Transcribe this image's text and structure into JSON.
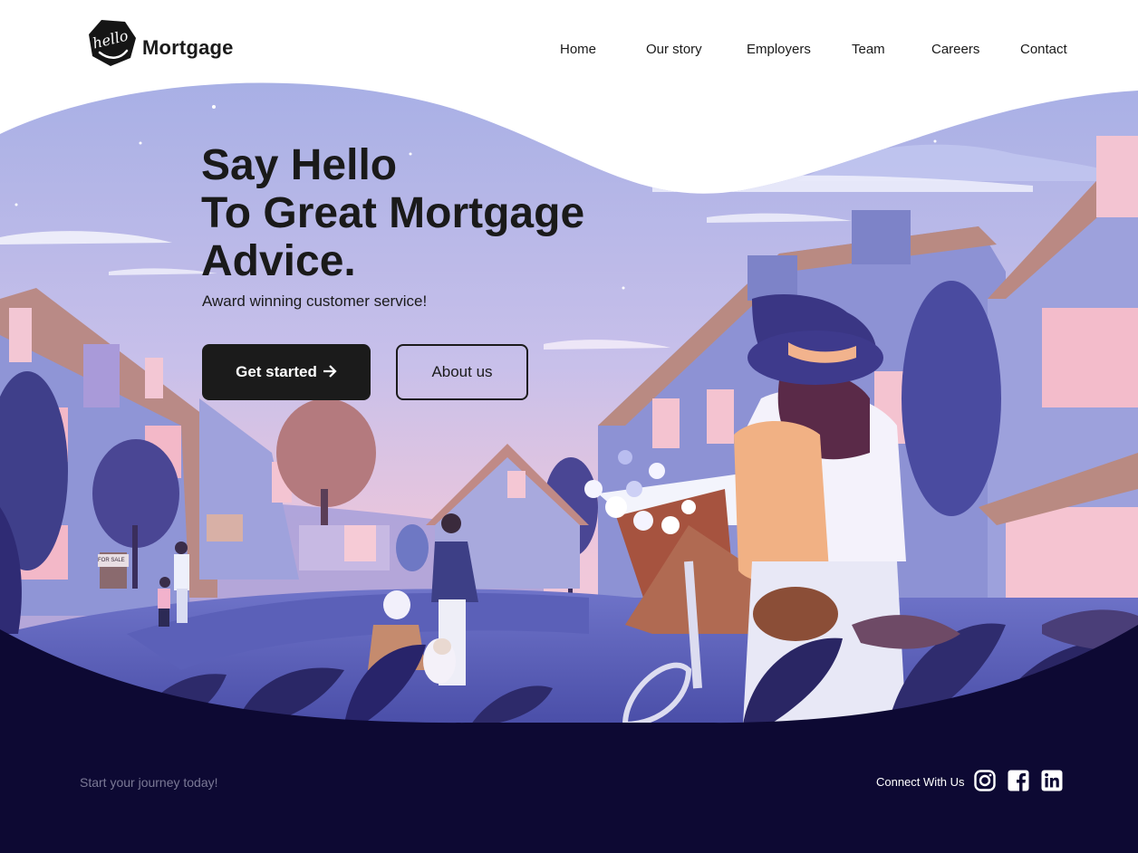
{
  "brand": {
    "logo_script": "hello",
    "name": "Mortgage"
  },
  "nav": {
    "items": [
      "Home",
      "Our story",
      "Employers",
      "Team",
      "Careers",
      "Contact"
    ]
  },
  "hero": {
    "title_lines": [
      "Say Hello",
      "To Great Mortgage",
      "Advice."
    ],
    "subtitle": "Award winning customer service!",
    "primary_button": "Get started",
    "primary_button_icon": "arrow-right-icon",
    "secondary_button": "About us",
    "illustration_sign": "FOR SALE"
  },
  "footer": {
    "tagline": "Start your journey today!",
    "connect_label": "Connect With Us",
    "social_icons": [
      "instagram-icon",
      "facebook-icon",
      "linkedin-icon"
    ]
  },
  "colors": {
    "dark_navy": "#0d0933",
    "sky_top": "#aab1e6",
    "sky_pink": "#f3c6d6",
    "button_dark": "#1b1b1b",
    "footer_muted_text": "#7a7895"
  }
}
